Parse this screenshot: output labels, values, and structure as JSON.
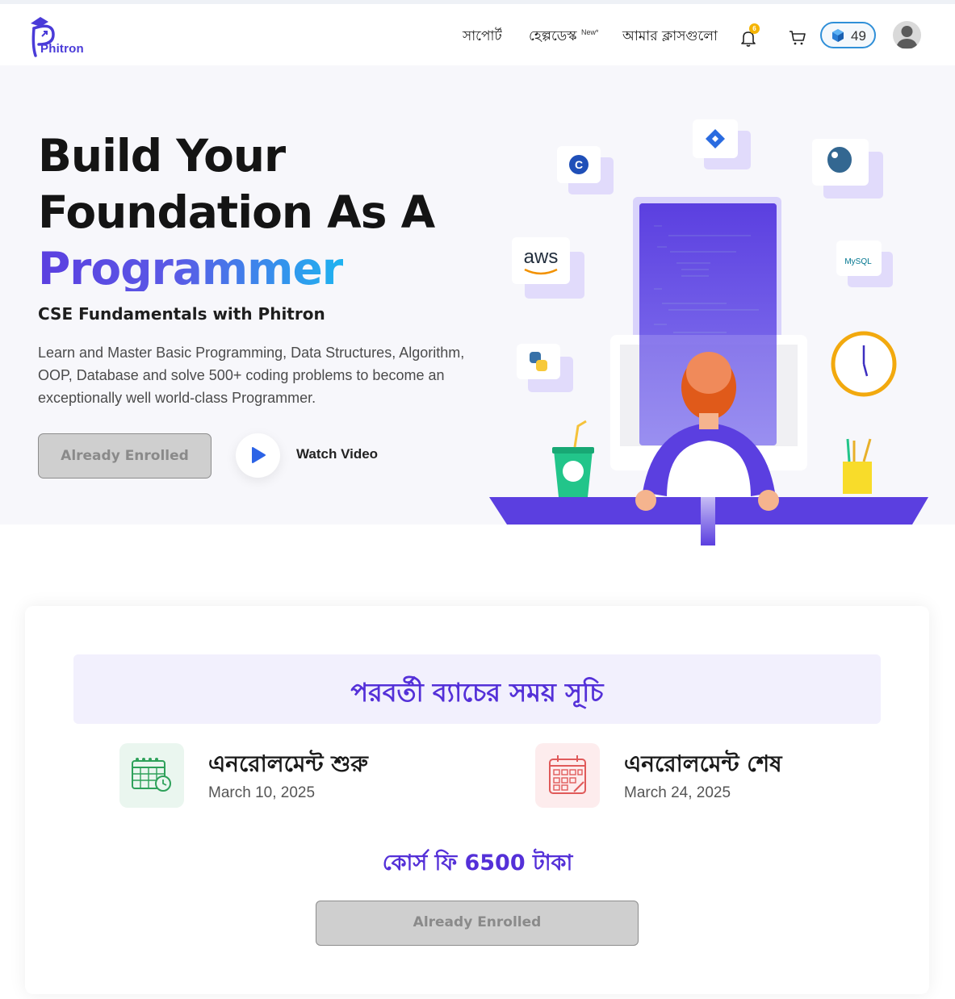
{
  "nav": {
    "logo_text": "Phitron",
    "support": "সাপোর্ট",
    "helpdesk": "হেল্পডেস্ক",
    "helpdesk_badge": "New*",
    "my_classes": "আমার ক্লাসগুলো",
    "notification_count": "6",
    "points": "49"
  },
  "hero": {
    "title_line1": "Build Your",
    "title_line2": "Foundation As A",
    "title_line3": "Programmer",
    "subtitle": "CSE Fundamentals with Phitron",
    "description": "Learn and Master Basic Programming, Data Structures, Algorithm, OOP, Database and solve 500+ coding problems to become an exceptionally well world-class Programmer.",
    "enroll_button": "Already Enrolled",
    "watch_video": "Watch Video",
    "logos": {
      "aws": "aws",
      "mysql": "MySQL",
      "c": "C"
    }
  },
  "schedule": {
    "title": "পরবর্তী ব্যাচের সময় সূচি",
    "start_label": "এনরোলমেন্ট শুরু",
    "start_date": "March 10, 2025",
    "end_label": "এনরোলমেন্ট শেষ",
    "end_date": "March 24, 2025",
    "fee": "কোর্স ফি 6500 টাকা",
    "enroll_button": "Already Enrolled"
  },
  "colors": {
    "brand_purple": "#5430d8",
    "gradient_end": "#1fb3f0",
    "badge_yellow": "#f5b400",
    "points_border": "#2f8fd8"
  }
}
